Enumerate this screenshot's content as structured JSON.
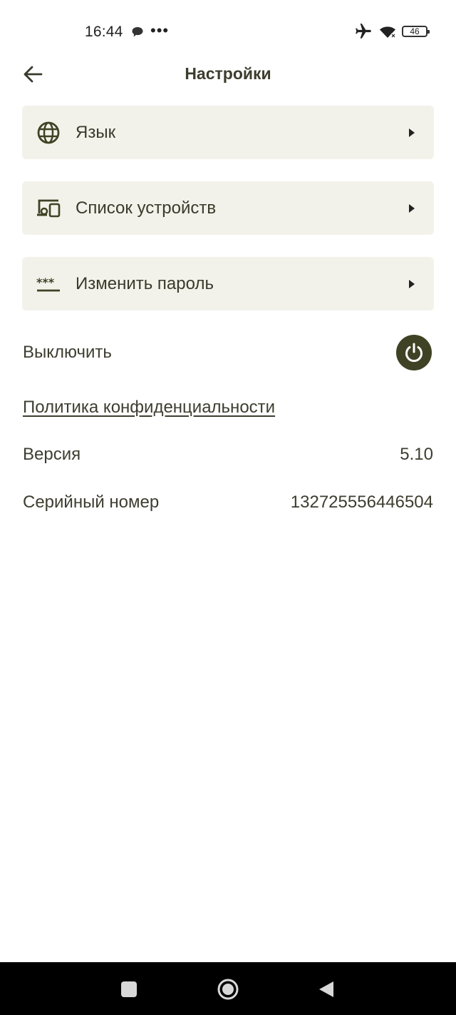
{
  "status_bar": {
    "time": "16:44",
    "notification_dots": "•••",
    "battery": "46",
    "icons": [
      "chat-icon",
      "airplane-icon",
      "wifi-icon",
      "battery-icon"
    ]
  },
  "header": {
    "title": "Настройки",
    "back_icon": "arrow-left-icon"
  },
  "menu": {
    "items": [
      {
        "label": "Язык",
        "icon": "globe-icon"
      },
      {
        "label": "Список устройств",
        "icon": "devices-icon"
      },
      {
        "label": "Изменить пароль",
        "icon": "password-icon"
      }
    ]
  },
  "power": {
    "label": "Выключить",
    "icon": "power-icon"
  },
  "privacy": {
    "label": "Политика конфиденциальности"
  },
  "info": {
    "version_label": "Версия",
    "version_value": "5.10",
    "serial_label": "Серийный номер",
    "serial_value": "132725556446504"
  },
  "colors": {
    "accent": "#3f4224",
    "card_background": "#f3f2ea",
    "text": "#3d3d30"
  },
  "nav_bar": {
    "icons": [
      "recents-icon",
      "home-icon",
      "back-triangle-icon"
    ]
  }
}
